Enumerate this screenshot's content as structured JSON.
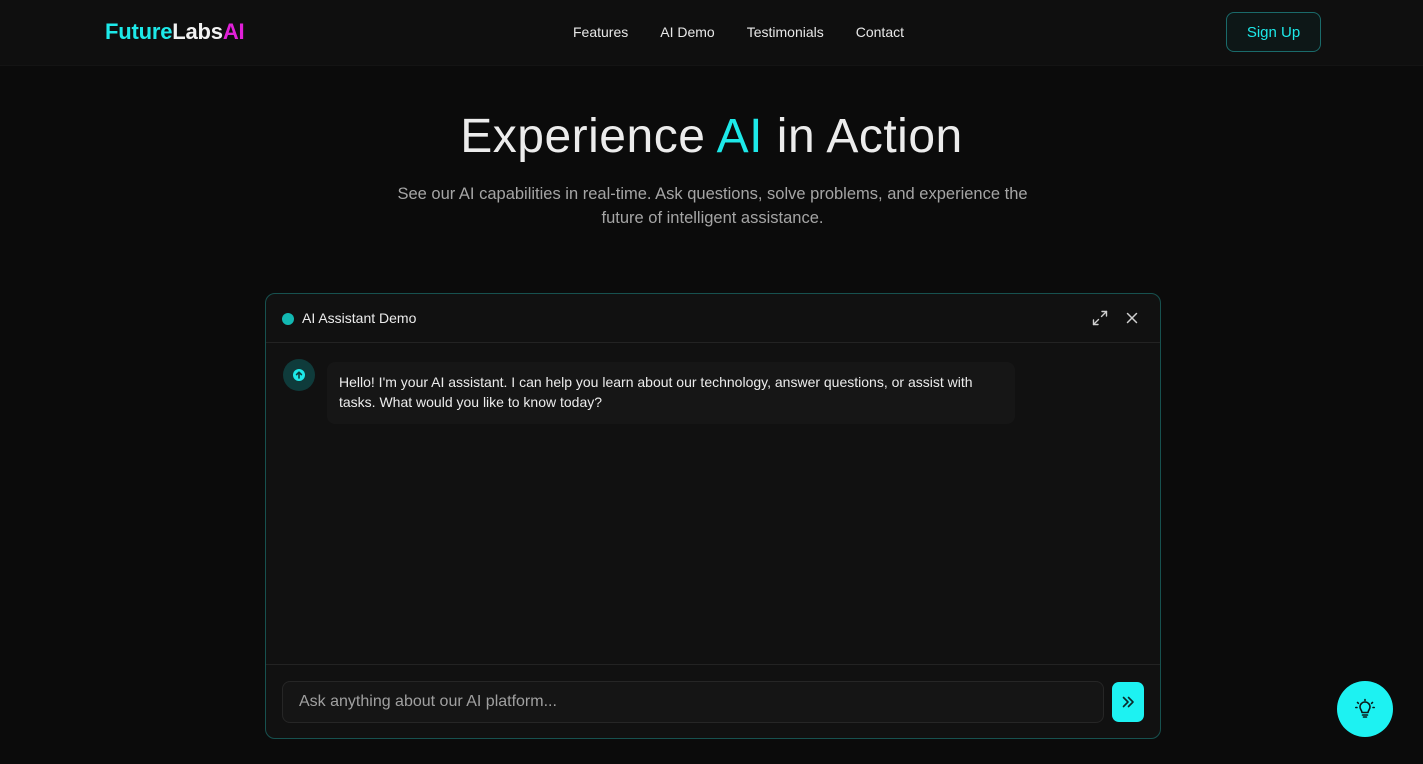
{
  "brand": {
    "part1": "Future",
    "part2": "Labs",
    "part3": "AI",
    "colors": {
      "cyan": "#1de9e9",
      "white": "#f2f2f2",
      "magenta": "#e020d8"
    }
  },
  "nav": {
    "links": [
      "Features",
      "AI Demo",
      "Testimonials",
      "Contact"
    ],
    "signup_label": "Sign Up"
  },
  "hero": {
    "title_pre": "Experience ",
    "title_accent": "AI",
    "title_post": " in Action",
    "subtitle": "See our AI capabilities in real-time. Ask questions, solve problems, and experience the future of intelligent assistance."
  },
  "chat": {
    "title": "AI Assistant Demo",
    "status_color": "#12b8b2",
    "header_icons": [
      "expand-icon",
      "close-icon"
    ],
    "messages": [
      {
        "role": "assistant",
        "text": "Hello! I'm your AI assistant. I can help you learn about our technology, answer questions, or assist with tasks. What would you like to know today?"
      }
    ],
    "input_placeholder": "Ask anything about our AI platform...",
    "input_value": "",
    "send_icon": "double-chevron-right-icon"
  },
  "fab": {
    "icon": "lightbulb-icon",
    "color": "#1df2f2"
  }
}
